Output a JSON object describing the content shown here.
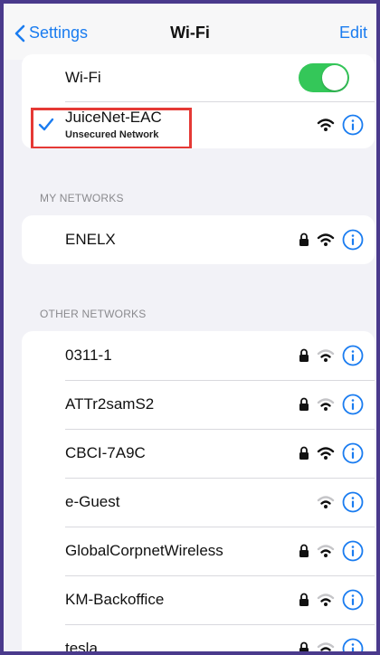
{
  "nav": {
    "back_label": "Settings",
    "title": "Wi-Fi",
    "edit_label": "Edit"
  },
  "wifi_toggle": {
    "label": "Wi-Fi",
    "state": "on"
  },
  "connected": {
    "name": "JuiceNet-EAC",
    "subtitle": "Unsecured Network"
  },
  "my_networks": {
    "header": "MY NETWORKS",
    "items": [
      {
        "name": "ENELX",
        "locked": true
      }
    ]
  },
  "other_networks": {
    "header": "OTHER NETWORKS",
    "items": [
      {
        "name": "0311-1",
        "locked": true
      },
      {
        "name": "ATTr2samS2",
        "locked": true
      },
      {
        "name": "CBCI-7A9C",
        "locked": true
      },
      {
        "name": "e-Guest",
        "locked": false
      },
      {
        "name": "GlobalCorpnetWireless",
        "locked": true
      },
      {
        "name": "KM-Backoffice",
        "locked": true
      },
      {
        "name": "tesla",
        "locked": true
      }
    ]
  },
  "colors": {
    "accent": "#1a7cf0",
    "toggle_on": "#34c759",
    "highlight": "#e53935"
  },
  "icons": [
    "chevron-left-icon",
    "checkmark-icon",
    "lock-icon",
    "wifi-icon",
    "info-icon"
  ]
}
